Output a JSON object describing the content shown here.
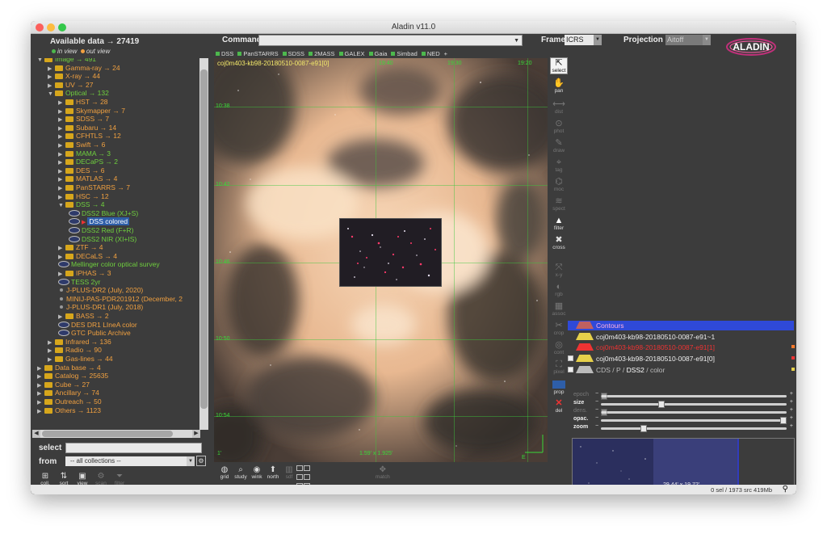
{
  "window": {
    "title": "Aladin v11.0"
  },
  "left": {
    "available_data": "Available data → 27419",
    "legend_in": "in view",
    "legend_out": "out view",
    "tree": [
      {
        "label": "Image → 491",
        "color": "c-g",
        "indent": 0,
        "kind": "folder",
        "arrow": "▼",
        "partial": true
      },
      {
        "label": "Gamma-ray → 24",
        "color": "c-o",
        "indent": 1,
        "kind": "folder",
        "arrow": "▶"
      },
      {
        "label": "X-ray → 44",
        "color": "c-o",
        "indent": 1,
        "kind": "folder",
        "arrow": "▶"
      },
      {
        "label": "UV → 27",
        "color": "c-o",
        "indent": 1,
        "kind": "folder",
        "arrow": "▶"
      },
      {
        "label": "Optical → 132",
        "color": "c-g",
        "indent": 1,
        "kind": "folder",
        "arrow": "▼"
      },
      {
        "label": "HST → 28",
        "color": "c-o",
        "indent": 2,
        "kind": "folder",
        "arrow": "▶"
      },
      {
        "label": "Skymapper → 7",
        "color": "c-o",
        "indent": 2,
        "kind": "folder",
        "arrow": "▶"
      },
      {
        "label": "SDSS → 7",
        "color": "c-o",
        "indent": 2,
        "kind": "folder",
        "arrow": "▶"
      },
      {
        "label": "Subaru → 14",
        "color": "c-o",
        "indent": 2,
        "kind": "folder",
        "arrow": "▶"
      },
      {
        "label": "CFHTLS → 12",
        "color": "c-o",
        "indent": 2,
        "kind": "folder",
        "arrow": "▶"
      },
      {
        "label": "Swift → 6",
        "color": "c-o",
        "indent": 2,
        "kind": "folder",
        "arrow": "▶"
      },
      {
        "label": "MAMA → 3",
        "color": "c-g",
        "indent": 2,
        "kind": "folder",
        "arrow": "▶"
      },
      {
        "label": "DECaPS → 2",
        "color": "c-g",
        "indent": 2,
        "kind": "folder",
        "arrow": "▶"
      },
      {
        "label": "DES → 6",
        "color": "c-o",
        "indent": 2,
        "kind": "folder",
        "arrow": "▶"
      },
      {
        "label": "MATLAS → 4",
        "color": "c-o",
        "indent": 2,
        "kind": "folder",
        "arrow": "▶"
      },
      {
        "label": "PanSTARRS → 7",
        "color": "c-o",
        "indent": 2,
        "kind": "folder",
        "arrow": "▶"
      },
      {
        "label": "HSC → 12",
        "color": "c-o",
        "indent": 2,
        "kind": "folder",
        "arrow": "▶"
      },
      {
        "label": "DSS → 4",
        "color": "c-g",
        "indent": 2,
        "kind": "folder",
        "arrow": "▼"
      },
      {
        "label": "DSS2 Blue (XJ+S)",
        "color": "c-g",
        "indent": 3,
        "kind": "survey"
      },
      {
        "label": "DSS colored",
        "color": "c-w",
        "indent": 3,
        "kind": "survey-sel"
      },
      {
        "label": "DSS2 Red (F+R)",
        "color": "c-g",
        "indent": 3,
        "kind": "survey"
      },
      {
        "label": "DSS2 NIR (XI+IS)",
        "color": "c-g",
        "indent": 3,
        "kind": "survey"
      },
      {
        "label": "ZTF → 4",
        "color": "c-o",
        "indent": 2,
        "kind": "folder",
        "arrow": "▶"
      },
      {
        "label": "DECaLS → 4",
        "color": "c-o",
        "indent": 2,
        "kind": "folder",
        "arrow": "▶"
      },
      {
        "label": "Mellinger color optical survey",
        "color": "c-g",
        "indent": 2,
        "kind": "survey"
      },
      {
        "label": "IPHAS → 3",
        "color": "c-o",
        "indent": 2,
        "kind": "folder",
        "arrow": "▶"
      },
      {
        "label": "TESS 2yr",
        "color": "c-g",
        "indent": 2,
        "kind": "survey"
      },
      {
        "label": "J-PLUS-DR2 (July, 2020)",
        "color": "c-o",
        "indent": 2,
        "kind": "bullet"
      },
      {
        "label": "MINIJ-PAS-PDR201912 (December, 2",
        "color": "c-o",
        "indent": 2,
        "kind": "bullet"
      },
      {
        "label": "J-PLUS-DR1 (July, 2018)",
        "color": "c-o",
        "indent": 2,
        "kind": "bullet"
      },
      {
        "label": "BASS → 2",
        "color": "c-o",
        "indent": 2,
        "kind": "folder",
        "arrow": "▶"
      },
      {
        "label": "DES DR1 LIneA color",
        "color": "c-o",
        "indent": 2,
        "kind": "survey"
      },
      {
        "label": "GTC Public Archive",
        "color": "c-o",
        "indent": 2,
        "kind": "survey"
      },
      {
        "label": "Infrared → 136",
        "color": "c-o",
        "indent": 1,
        "kind": "folder",
        "arrow": "▶"
      },
      {
        "label": "Radio → 90",
        "color": "c-o",
        "indent": 1,
        "kind": "folder",
        "arrow": "▶"
      },
      {
        "label": "Gas-lines → 44",
        "color": "c-o",
        "indent": 1,
        "kind": "folder",
        "arrow": "▶"
      },
      {
        "label": "Data base → 4",
        "color": "c-o",
        "indent": 0,
        "kind": "folder",
        "arrow": "▶"
      },
      {
        "label": "Catalog → 25635",
        "color": "c-o",
        "indent": 0,
        "kind": "folder",
        "arrow": "▶"
      },
      {
        "label": "Cube → 27",
        "color": "c-o",
        "indent": 0,
        "kind": "folder",
        "arrow": "▶"
      },
      {
        "label": "Ancillary → 74",
        "color": "c-o",
        "indent": 0,
        "kind": "folder",
        "arrow": "▶"
      },
      {
        "label": "Outreach → 50",
        "color": "c-o",
        "indent": 0,
        "kind": "folder",
        "arrow": "▶"
      },
      {
        "label": "Others → 1123",
        "color": "c-o",
        "indent": 0,
        "kind": "folder",
        "arrow": "▶",
        "partial": true
      }
    ],
    "select_label": "select",
    "from_label": "from",
    "from_value": "-- all collections --",
    "tools": [
      {
        "icon": "⊞",
        "label": "coll.",
        "icon_name": "collapse-icon"
      },
      {
        "icon": "⇅",
        "label": "sort",
        "icon_name": "sort-icon"
      },
      {
        "icon": "▣",
        "label": "view",
        "icon_name": "view-icon"
      },
      {
        "icon": "⚙",
        "label": "scan",
        "icon_name": "scan-icon"
      },
      {
        "icon": "⏷",
        "label": "filter",
        "icon_name": "filter-icon"
      }
    ]
  },
  "topbar": {
    "command_label": "Command",
    "frame_label": "Frame",
    "frame_value": "ICRS",
    "projection_label": "Projection",
    "projection_value": "Aitoff",
    "logo_text": "ALADIN"
  },
  "shortcuts": [
    "DSS",
    "PanSTARRS",
    "SDSS",
    "2MASS",
    "GALEX",
    "Gaia",
    "Simbad",
    "NED",
    "+"
  ],
  "viewer": {
    "title": "coj0m403-kb98-20180510-0087-e91[0]",
    "ra_ticks": [
      "19:40",
      "19:30",
      "19:20"
    ],
    "dec_ticks": [
      "10:38",
      "10:42",
      "10:46",
      "10:50",
      "10:54"
    ],
    "scale": "1.59' x 1.925'",
    "compass_label": "E",
    "corner_label": "1'"
  },
  "under_tools": [
    {
      "icon": "◍",
      "label": "grid",
      "icon_name": "grid-icon"
    },
    {
      "icon": "⌕",
      "label": "study",
      "icon_name": "study-icon"
    },
    {
      "icon": "◉",
      "label": "wink",
      "icon_name": "wink-icon"
    },
    {
      "icon": "⬆",
      "label": "north",
      "icon_name": "north-icon"
    },
    {
      "icon": "▥",
      "label": "sdf",
      "icon_name": "sdf-icon"
    }
  ],
  "multiview_label": "multiview",
  "match_label": "match",
  "vtools": [
    {
      "icon": "⇱",
      "label": "select",
      "state": "active",
      "icon_name": "select-arrow-icon"
    },
    {
      "icon": "✋",
      "label": "pan",
      "state": "normal",
      "icon_name": "pan-hand-icon"
    },
    {
      "icon": "⟷",
      "label": "dist",
      "state": "dim",
      "icon_name": "dist-icon"
    },
    {
      "icon": "⊙",
      "label": "phot",
      "state": "dim",
      "icon_name": "phot-icon"
    },
    {
      "icon": "✎",
      "label": "draw",
      "state": "dim",
      "icon_name": "draw-icon"
    },
    {
      "icon": "⌖",
      "label": "tag",
      "state": "dim",
      "icon_name": "tag-icon"
    },
    {
      "icon": "⌬",
      "label": "moc",
      "state": "dim",
      "icon_name": "moc-icon"
    },
    {
      "icon": "≋",
      "label": "spect",
      "state": "dim",
      "icon_name": "spect-icon"
    },
    {
      "icon": "▲",
      "label": "filter",
      "state": "normal",
      "icon_name": "filter-icon"
    },
    {
      "icon": "✖",
      "label": "cross",
      "state": "normal",
      "icon_name": "cross-icon"
    },
    {
      "icon": "⤧",
      "label": "x-y",
      "state": "dim",
      "icon_name": "xy-icon"
    },
    {
      "icon": "◐",
      "label": "rgb",
      "state": "dim",
      "icon_name": "rgb-icon"
    },
    {
      "icon": "▦",
      "label": "assoc",
      "state": "dim",
      "icon_name": "assoc-icon"
    },
    {
      "icon": "✂",
      "label": "crop",
      "state": "dim",
      "icon_name": "crop-icon"
    },
    {
      "icon": "◎",
      "label": "cont",
      "state": "dim",
      "icon_name": "cont-icon"
    },
    {
      "icon": "⛶",
      "label": "pixel",
      "state": "dim",
      "icon_name": "pixel-icon"
    },
    {
      "icon": "",
      "label": "prop",
      "state": "prop",
      "icon_name": "prop-icon"
    },
    {
      "icon": "✕",
      "label": "del",
      "state": "del",
      "icon_name": "delete-icon"
    }
  ],
  "stack": [
    {
      "label": "Contours",
      "style": "contours",
      "checked": false
    },
    {
      "label": "coj0m403-kb98-20180510-0087-e91~1",
      "style": "plane-w",
      "checked": false
    },
    {
      "label": "coj0m403-kb98-20180510-0087-e91[1]",
      "style": "plane-r",
      "checked": false
    },
    {
      "label": "coj0m403-kb98-20180510-0087-e91[0]",
      "style": "plane-w",
      "checked": true
    },
    {
      "label_prefix": "CDS / P / ",
      "label_main": "DSS2",
      "label_suffix": " / color",
      "style": "survey",
      "checked": true
    }
  ],
  "sliders": [
    {
      "label": "epoch",
      "enabled": false,
      "value": 0.0
    },
    {
      "label": "size",
      "enabled": true,
      "value": 0.32
    },
    {
      "label": "dens.",
      "enabled": false,
      "value": 0.0
    },
    {
      "label": "opac.",
      "enabled": true,
      "value": 1.0
    },
    {
      "label": "zoom",
      "enabled": true,
      "value": 0.22
    }
  ],
  "preview": {
    "size": "29.44' x 19.72'"
  },
  "status": "0 sel / 1973 src   419Mb"
}
